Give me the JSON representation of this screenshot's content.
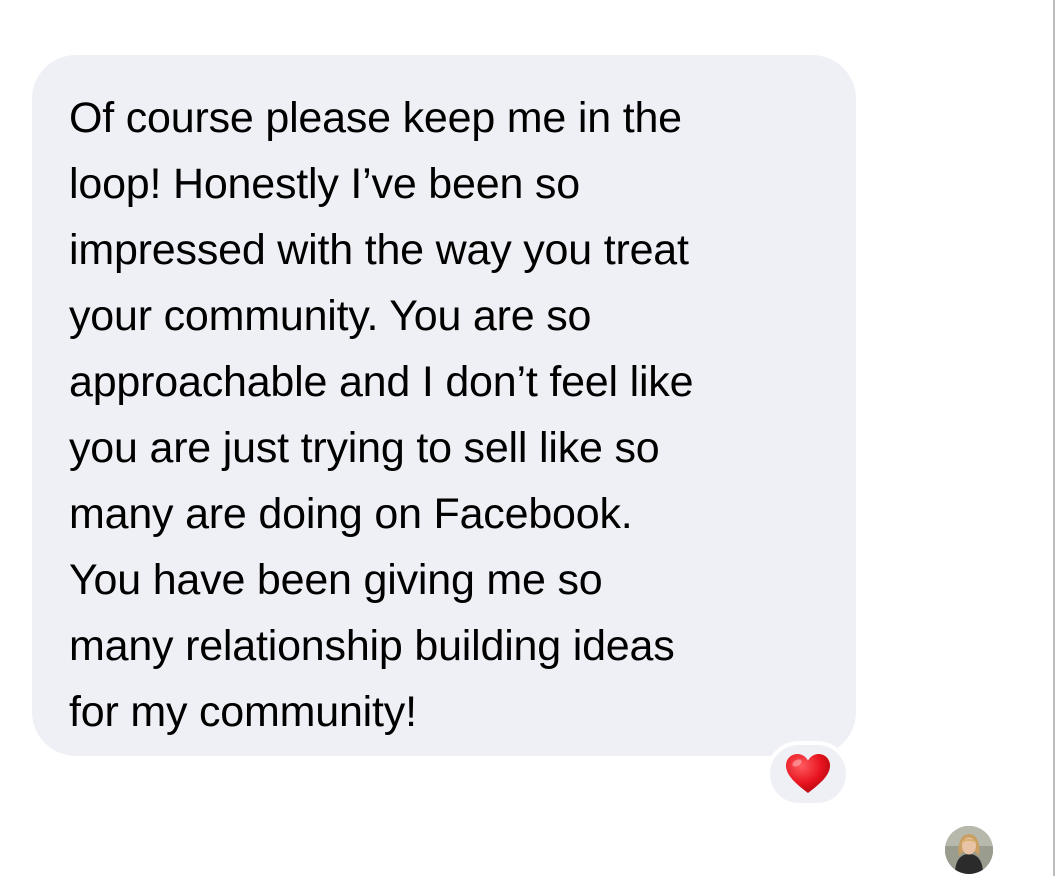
{
  "message": {
    "text": "Of course please keep me in the\nloop! Honestly I’ve been so\nimpressed with the way you treat\nyour community. You are so\napproachable and I don’t feel like\nyou are just trying to sell like so\nmany are doing on Facebook.\nYou have been giving me so\nmany relationship building ideas\nfor my community!",
    "bubble_color": "#eff0f5",
    "text_color": "#000000"
  },
  "reaction": {
    "icon": "red-heart-icon",
    "color": "#e8141f"
  },
  "avatar": {
    "icon": "user-avatar"
  }
}
